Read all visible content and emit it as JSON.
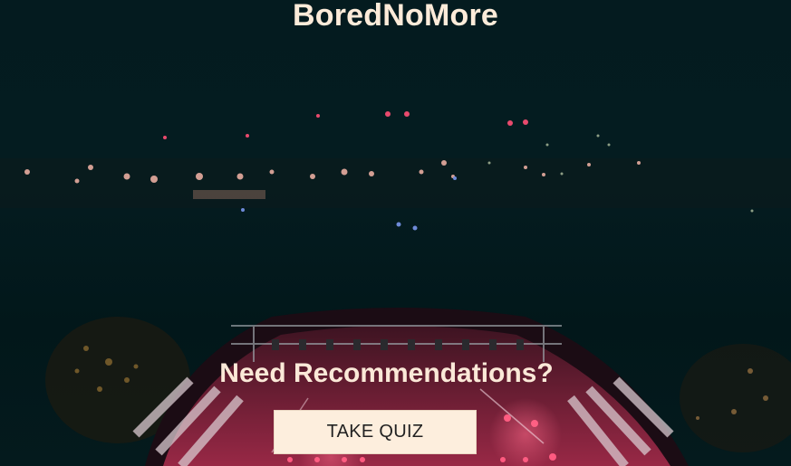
{
  "app": {
    "title": "BoredNoMore"
  },
  "hero": {
    "subtitle": "Need Recommendations?",
    "cta_label": "TAKE QUIZ",
    "background_image": "night concert stage with city lights"
  },
  "colors": {
    "background": "#031c20",
    "title_text": "#fcebd9",
    "button_bg": "#fdeedd",
    "button_text": "#222222"
  }
}
